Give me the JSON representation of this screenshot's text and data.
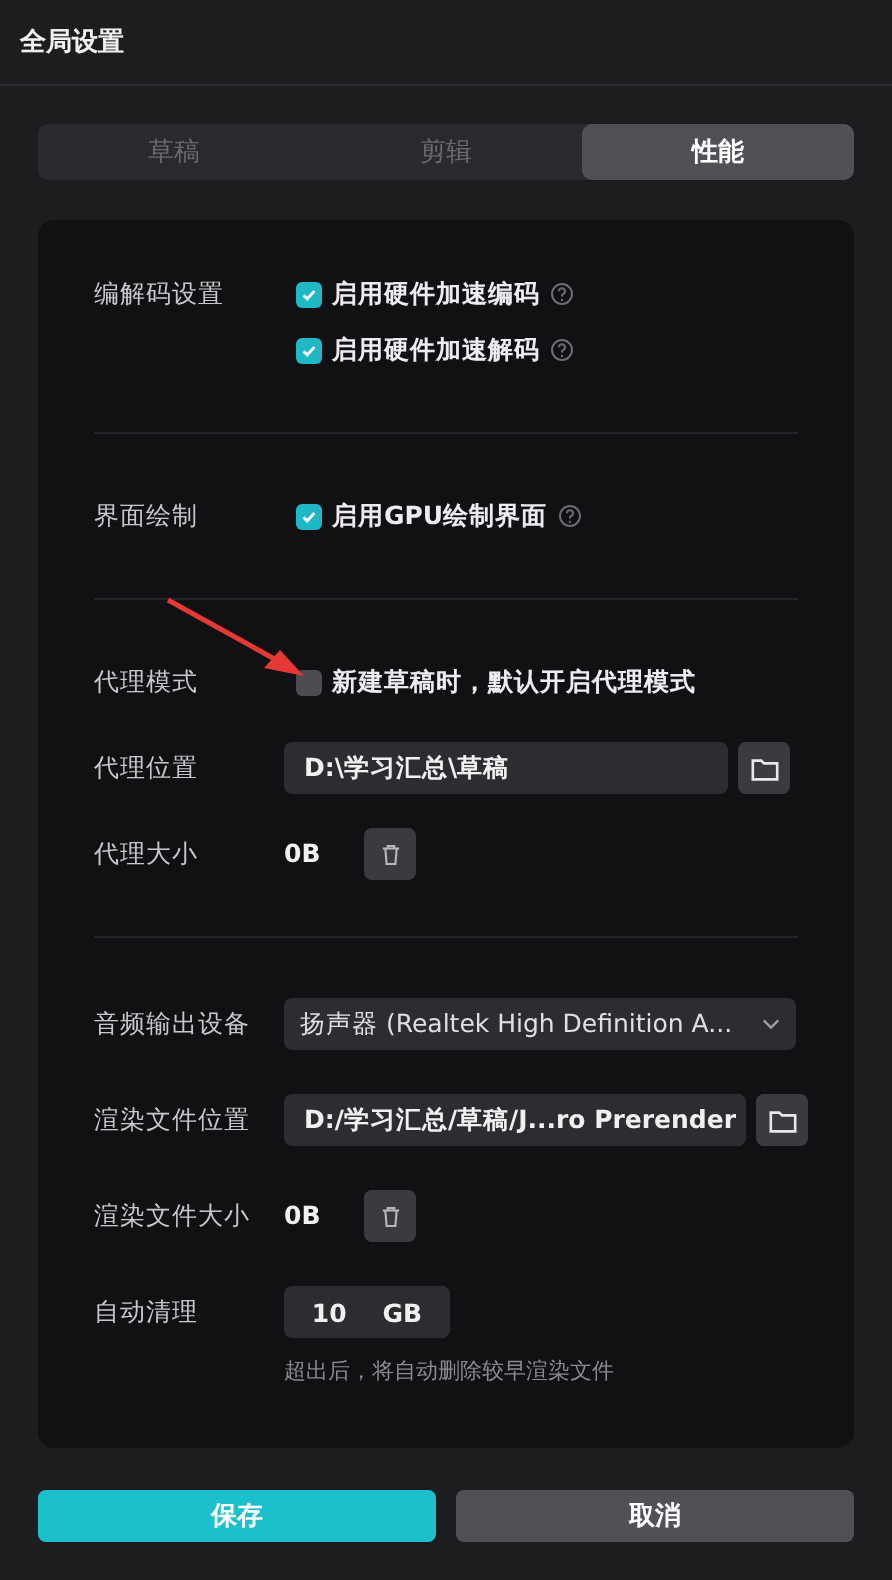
{
  "window": {
    "title": "全局设置"
  },
  "tabs": [
    {
      "label": "草稿",
      "selected": false
    },
    {
      "label": "剪辑",
      "selected": false
    },
    {
      "label": "性能",
      "selected": true
    }
  ],
  "sections": [
    {
      "rows": [
        {
          "kind": "checks",
          "label": "编解码设置",
          "options": [
            {
              "text": "启用硬件加速编码",
              "checked": true,
              "help": true
            },
            {
              "text": "启用硬件加速解码",
              "checked": true,
              "help": true
            }
          ]
        }
      ]
    },
    {
      "rows": [
        {
          "kind": "checks",
          "label": "界面绘制",
          "options": [
            {
              "text": "启用GPU绘制界面",
              "checked": true,
              "help": true
            }
          ]
        }
      ]
    },
    {
      "rows": [
        {
          "kind": "checks",
          "label": "代理模式",
          "pointed": true,
          "options": [
            {
              "text": "新建草稿时，默认开启代理模式",
              "checked": false,
              "help": false
            }
          ]
        },
        {
          "kind": "path",
          "label": "代理位置",
          "value": "D:\\学习汇总\\草稿"
        },
        {
          "kind": "size",
          "label": "代理大小",
          "value": "0B"
        }
      ]
    },
    {
      "rows": [
        {
          "kind": "select",
          "label": "音频输出设备",
          "value": "扬声器 (Realtek High Definition A..."
        },
        {
          "kind": "path",
          "label": "渲染文件位置",
          "value": "D:/学习汇总/草稿/J...ro Prerender"
        },
        {
          "kind": "size",
          "label": "渲染文件大小",
          "value": "0B"
        },
        {
          "kind": "number",
          "label": "自动清理",
          "value": "10",
          "unit": "GB",
          "hint": "超出后，将自动删除较早渲染文件"
        }
      ]
    }
  ],
  "buttons": [
    {
      "label": "保存",
      "kind": "primary"
    },
    {
      "label": "取消",
      "kind": "secondary"
    }
  ]
}
